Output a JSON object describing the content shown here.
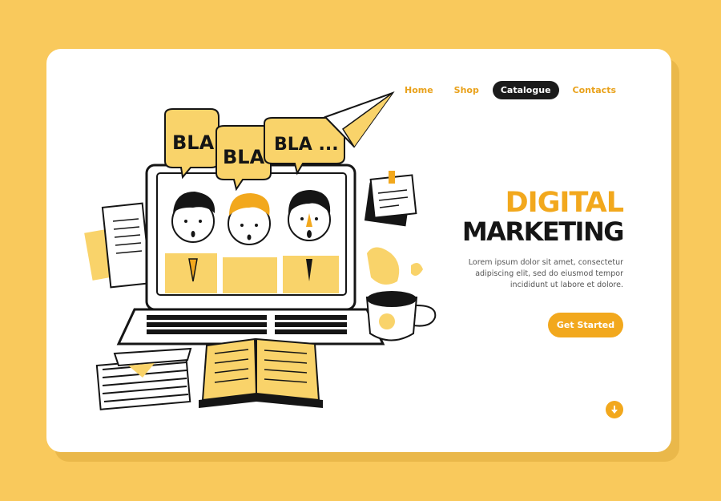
{
  "nav": {
    "items": [
      {
        "label": "Home",
        "active": false
      },
      {
        "label": "Shop",
        "active": false
      },
      {
        "label": "Catalogue",
        "active": true
      },
      {
        "label": "Contacts",
        "active": false
      }
    ]
  },
  "hero": {
    "title_line1": "DIGITAL",
    "title_line2": "MARKETING",
    "text_lines": [
      "Lorem ipsum dolor sit amet, consectetur",
      "adipiscing elit, sed do eiusmod tempor",
      "incididunt ut labore et dolore."
    ],
    "cta_label": "Get Started"
  },
  "illustration": {
    "bubbles": [
      "BLA",
      "BLA",
      "BLA ..."
    ]
  },
  "colors": {
    "background": "#f9c95c",
    "accent": "#f2a81d",
    "dark": "#1b1b1b",
    "card": "#ffffff"
  },
  "icons": {
    "scroll": "arrow-down-icon",
    "plane": "paper-plane-icon"
  }
}
